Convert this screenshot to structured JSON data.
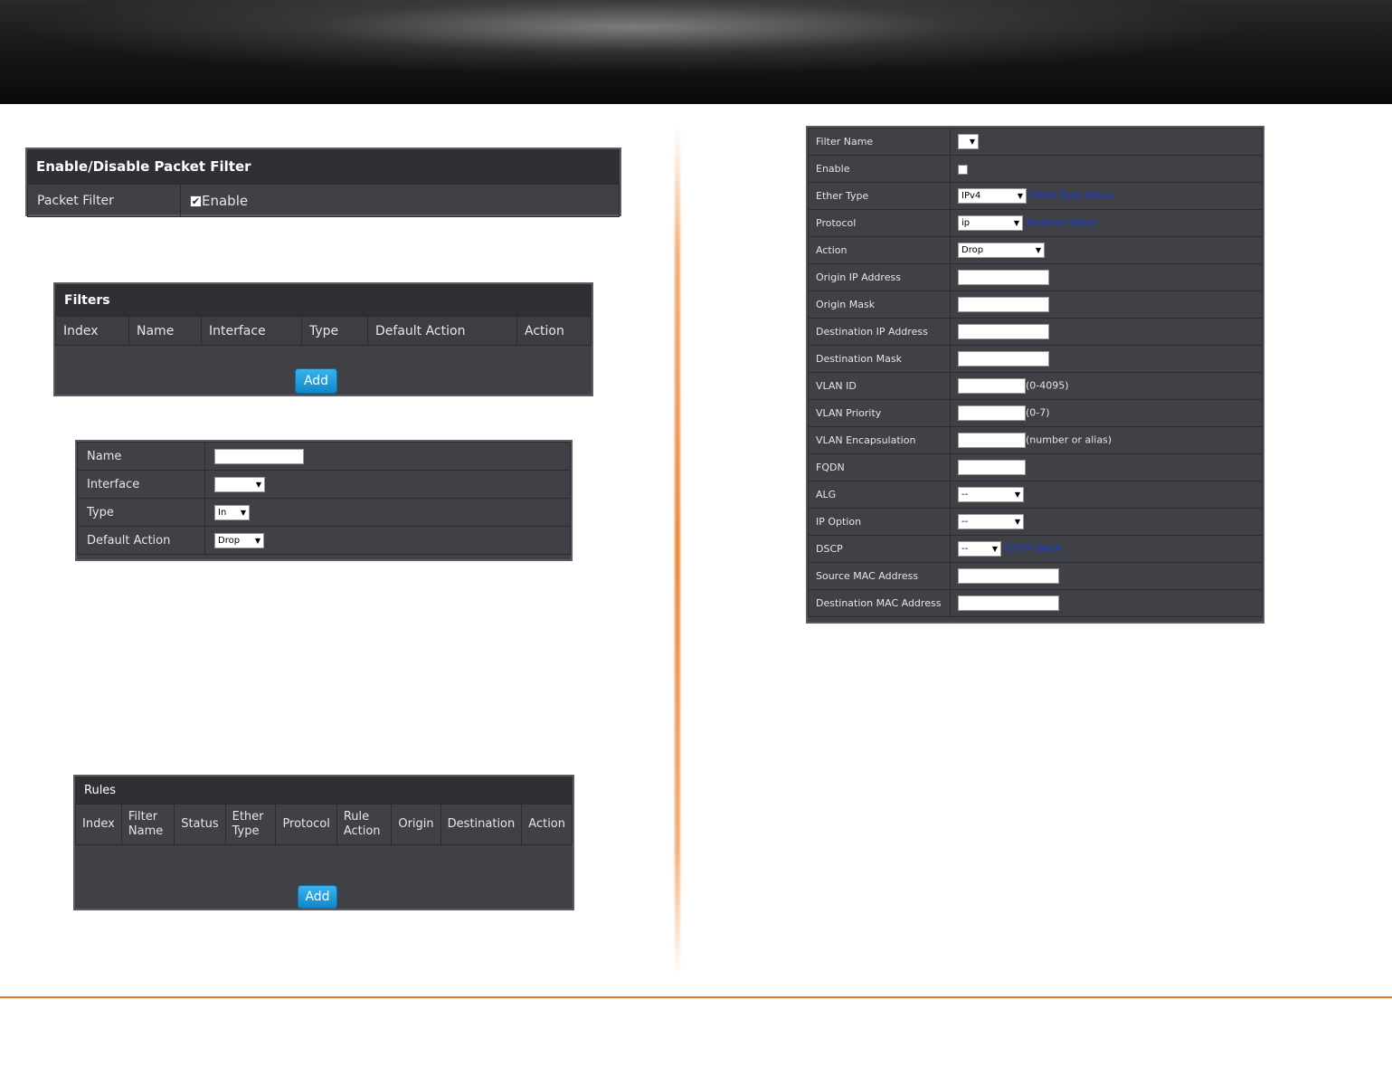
{
  "enable_panel": {
    "title": "Enable/Disable Packet Filter",
    "label": "Packet Filter",
    "checkbox_label": "Enable",
    "checked": true
  },
  "filters_panel": {
    "title": "Filters",
    "columns": [
      "Index",
      "Name",
      "Interface",
      "Type",
      "Default Action",
      "Action"
    ],
    "add_label": "Add"
  },
  "filter_form": {
    "name_label": "Name",
    "interface_label": "Interface",
    "interface_value": "",
    "type_label": "Type",
    "type_value": "In",
    "default_action_label": "Default Action",
    "default_action_value": "Drop"
  },
  "rules_panel": {
    "title": "Rules",
    "columns": [
      "Index",
      "Filter Name",
      "Status",
      "Ether Type",
      "Protocol",
      "Rule Action",
      "Origin",
      "Destination",
      "Action"
    ],
    "add_label": "Add"
  },
  "rule_form": {
    "filter_name_label": "Filter Name",
    "enable_label": "Enable",
    "ether_type_label": "Ether Type",
    "ether_type_value": "IPv4",
    "ether_type_link": "Ether Type Value",
    "protocol_label": "Protocol",
    "protocol_value": "ip",
    "protocol_link": "Protocol Value",
    "action_label": "Action",
    "action_value": "Drop",
    "origin_ip_label": "Origin IP Address",
    "origin_mask_label": "Origin Mask",
    "dest_ip_label": "Destination IP Address",
    "dest_mask_label": "Destination Mask",
    "vlan_id_label": "VLAN ID",
    "vlan_id_note": "(0-4095)",
    "vlan_priority_label": "VLAN Priority",
    "vlan_priority_note": "(0-7)",
    "vlan_encap_label": "VLAN Encapsulation",
    "vlan_encap_note": "(number or alias)",
    "fqdn_label": "FQDN",
    "alg_label": "ALG",
    "alg_value": "--",
    "ip_option_label": "IP Option",
    "ip_option_value": "--",
    "dscp_label": "DSCP",
    "dscp_value": "--",
    "dscp_link": "DSCP Value",
    "src_mac_label": "Source MAC Address",
    "dst_mac_label": "Destination MAC Address"
  }
}
